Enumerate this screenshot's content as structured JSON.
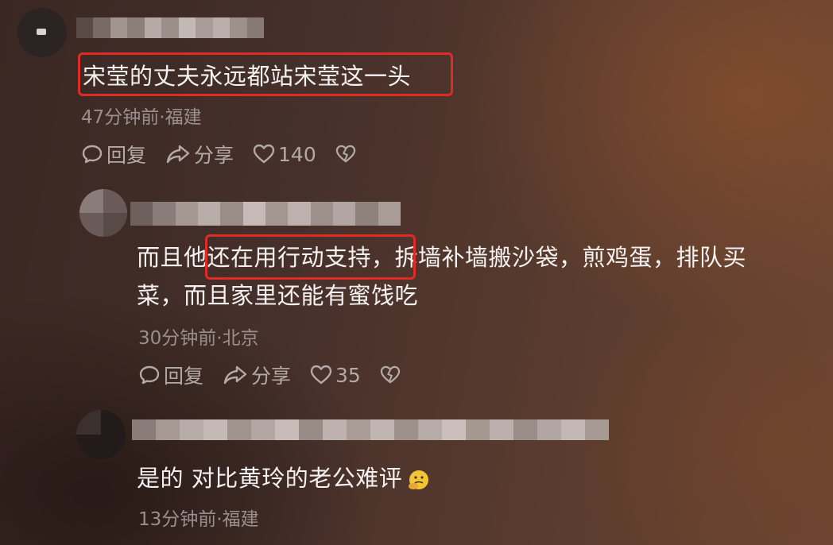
{
  "comments": [
    {
      "text": "宋莹的丈夫永远都站宋莹这一头",
      "meta": "47分钟前·福建",
      "reply_label": "回复",
      "share_label": "分享",
      "likes": "140"
    },
    {
      "text_line1_a": "而且他",
      "text_line1_b": "还在用行动支持，",
      "text_line1_c": "拆墙补墙搬沙袋，煎鸡蛋，排队买",
      "text_line2": "菜，而且家里还能有蜜饯吃",
      "meta": "30分钟前·北京",
      "reply_label": "回复",
      "share_label": "分享",
      "likes": "35"
    },
    {
      "text": "是的 对比黄玲的老公难评",
      "meta": "13分钟前·福建"
    }
  ],
  "icons": {
    "reply": "comment-bubble-icon",
    "share": "share-arrow-icon",
    "like": "heart-icon",
    "dislike": "broken-heart-icon",
    "emoji": "thinking-face-emoji"
  },
  "colors": {
    "highlight": "#e02a25",
    "meta": "#9a8f8c",
    "text": "#f4f1f0"
  }
}
